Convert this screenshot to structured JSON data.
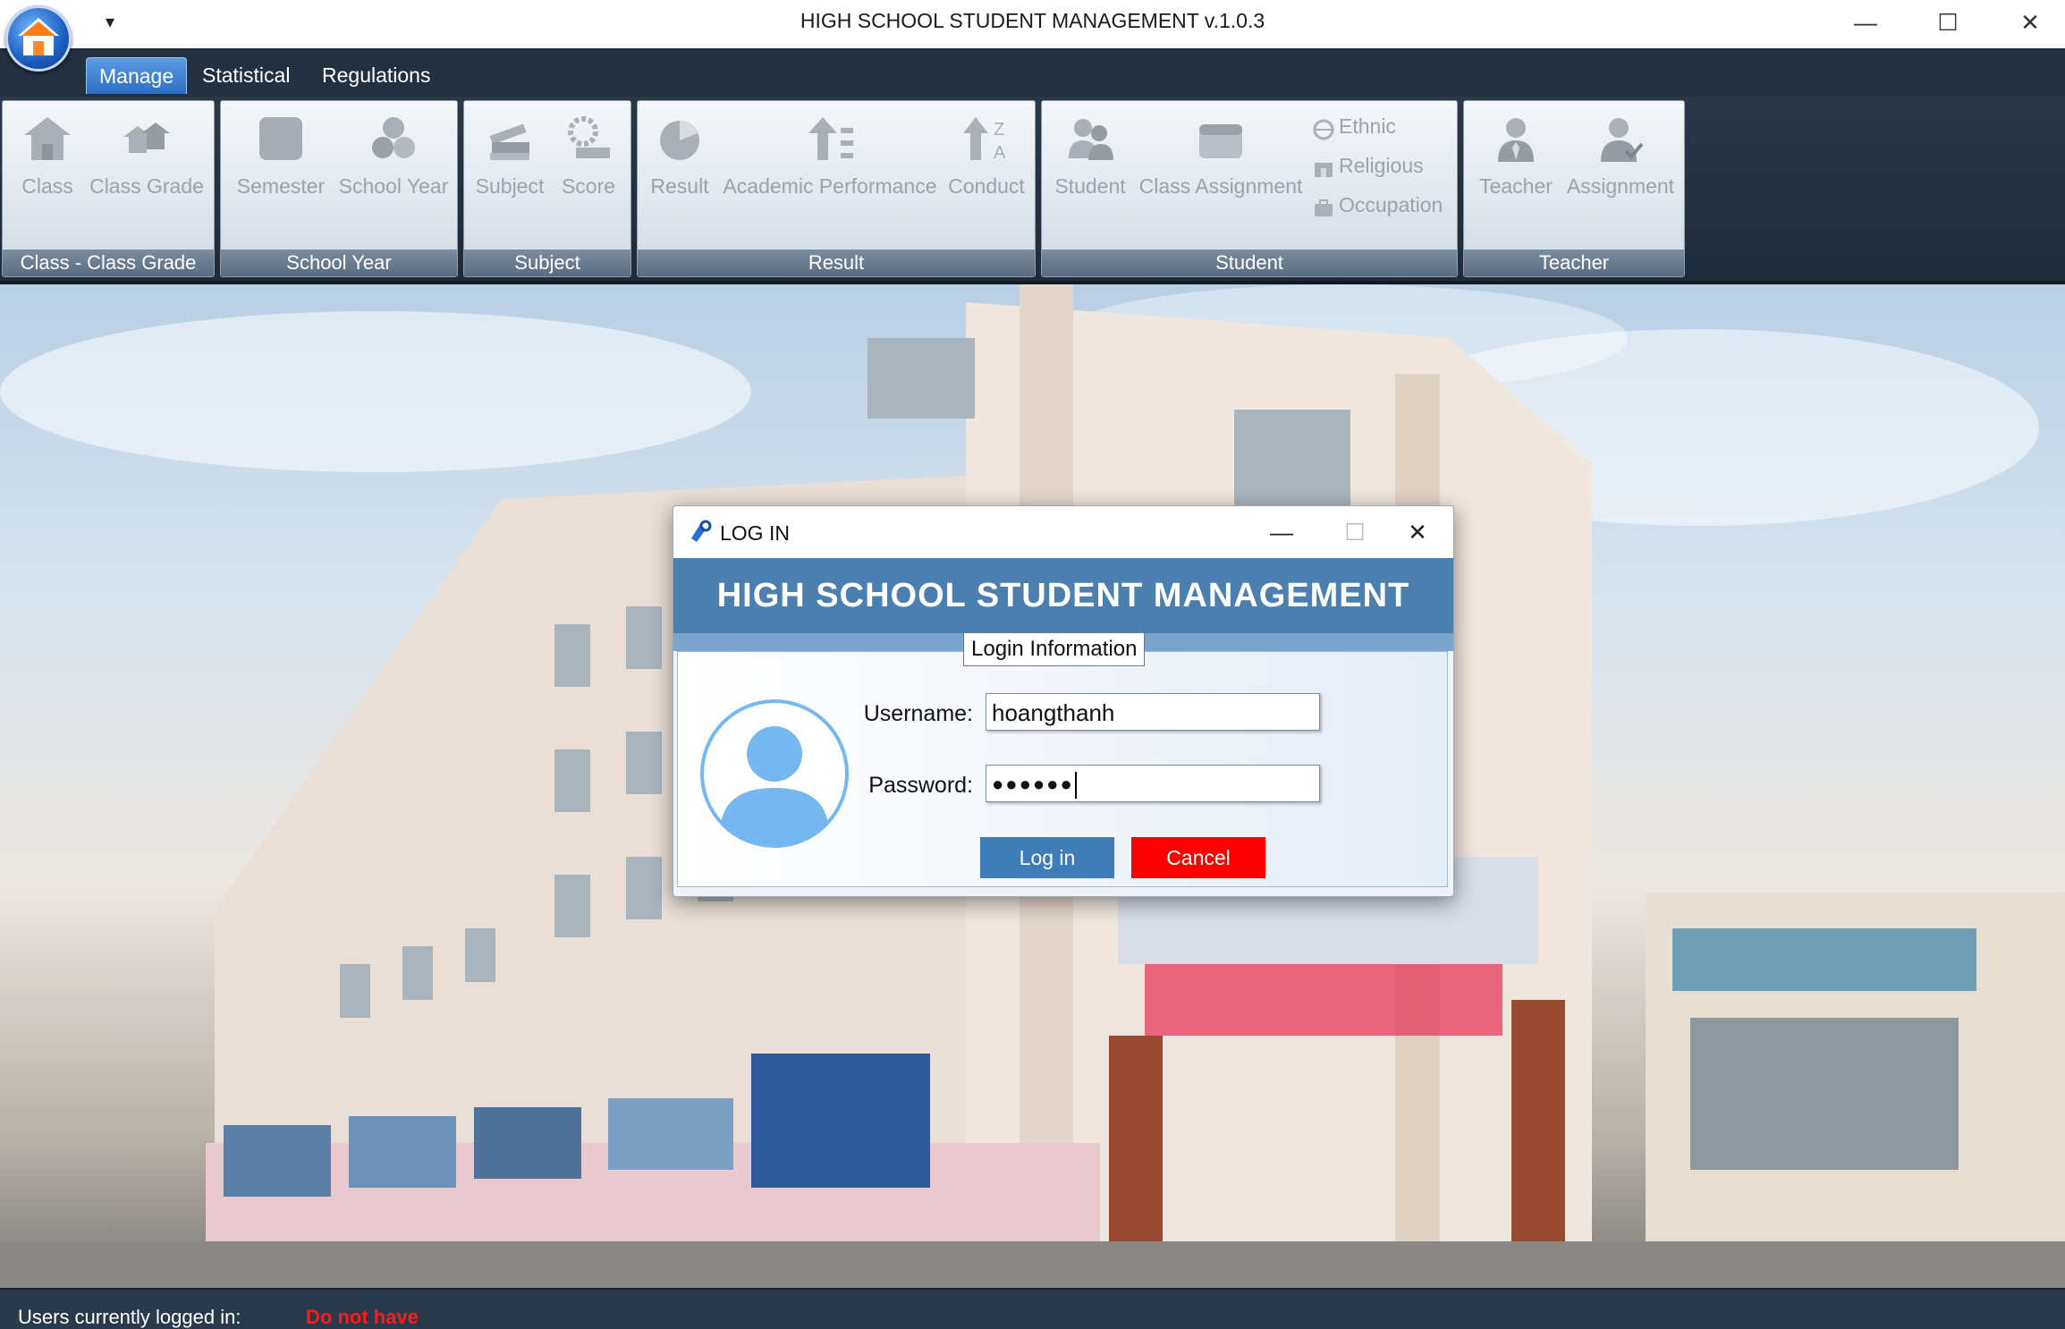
{
  "app": {
    "title": "HIGH SCHOOL STUDENT MANAGEMENT v.1.0.3",
    "qat_glyph": "▾"
  },
  "window_controls": {
    "minimize": "—",
    "maximize": "☐",
    "close": "✕"
  },
  "tabs": [
    {
      "label": "Manage",
      "active": true
    },
    {
      "label": "Statistical",
      "active": false
    },
    {
      "label": "Regulations",
      "active": false
    }
  ],
  "ribbon": {
    "groups": [
      {
        "label": "Class - Class Grade",
        "buttons": [
          "Class",
          "Class Grade"
        ]
      },
      {
        "label": "School Year",
        "buttons": [
          "Semester",
          "School Year"
        ]
      },
      {
        "label": "Subject",
        "buttons": [
          "Subject",
          "Score"
        ]
      },
      {
        "label": "Result",
        "buttons": [
          "Result",
          "Academic Performance",
          "Conduct"
        ]
      },
      {
        "label": "Student",
        "buttons": [
          "Student",
          "Class Assignment"
        ],
        "small_buttons": [
          "Ethnic",
          "Religious",
          "Occupation"
        ]
      },
      {
        "label": "Teacher",
        "buttons": [
          "Teacher",
          "Assignment"
        ]
      }
    ]
  },
  "login_dialog": {
    "title": "LOG IN",
    "banner": "HIGH SCHOOL STUDENT MANAGEMENT",
    "legend": "Login Information",
    "username_label": "Username:",
    "username_value": "hoangthanh",
    "password_label": "Password:",
    "password_value": "●●●●●●",
    "login_button": "Log in",
    "cancel_button": "Cancel",
    "controls": {
      "minimize": "—",
      "maximize": "☐",
      "close": "✕"
    }
  },
  "status_bar": {
    "label": "Users currently logged in:",
    "value": "Do not have",
    "value_color": "#ff1a1a"
  },
  "colors": {
    "accent": "#3f7db9",
    "cancel": "#ff0000",
    "banner": "#4a7fb0",
    "ribbon_dark": "#223040"
  }
}
